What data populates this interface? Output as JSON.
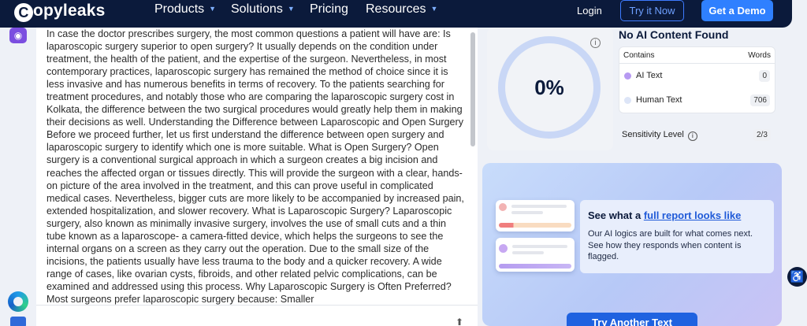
{
  "nav": {
    "logo": "opyleaks",
    "logo_mark": "C",
    "items": [
      {
        "label": "Products"
      },
      {
        "label": "Solutions"
      },
      {
        "label": "Pricing"
      },
      {
        "label": "Resources"
      }
    ],
    "login": "Login",
    "try_it_now": "Try it Now",
    "get_demo": "Get a Demo"
  },
  "text_panel": {
    "content": "In case the doctor prescribes surgery, the most common questions a patient will have are: Is laparoscopic surgery superior to open surgery? It usually depends on the condition under treatment, the health of the patient, and the expertise of the surgeon. Nevertheless, in most contemporary practices, laparoscopic surgery has remained the method of choice since it is less invasive and has numerous benefits in terms of recovery. To the patients searching for treatment procedures, and notably those who are comparing the laparoscopic surgery cost in Kolkata, the difference between the two surgical procedures would greatly help them in making their decisions as well. Understanding the Difference between Laparoscopic and Open Surgery Before we proceed further, let us first understand the difference between open surgery and laparoscopic surgery to identify which one is more suitable. What is Open Surgery? Open surgery is a conventional surgical approach in which a surgeon creates a big incision and reaches the affected organ or tissues directly. This will provide the surgeon with a clear, hands-on picture of the area involved in the treatment, and this can prove useful in complicated medical cases. Nevertheless, bigger cuts are more likely to be accompanied by increased pain, extended hospitalization, and slower recovery. What is Laparoscopic Surgery? Laparoscopic surgery, also known as minimally invasive surgery, involves the use of small cuts and a thin tube known as a laparoscope- a camera-fitted device, which helps the surgeons to see the internal organs on a screen as they carry out the operation. Due to the small size of the incisions, the patients usually have less trauma to the body and a quicker recovery. A wide range of cases, like ovarian cysts, fibroids, and other related pelvic complications, can be examined and addressed using this process. Why Laparoscopic Surgery is Often Preferred? Most surgeons prefer laparoscopic surgery because: Smaller"
  },
  "results": {
    "percent": "0%",
    "title": "No AI Content Found",
    "contains_label": "Contains",
    "words_label": "Words",
    "rows": [
      {
        "label": "AI Text",
        "count": "0",
        "color": "#b79af2"
      },
      {
        "label": "Human Text",
        "count": "706",
        "color": "#dde5f7"
      }
    ],
    "sensitivity_label": "Sensitivity Level",
    "sensitivity_value": "2/3"
  },
  "promo": {
    "title_prefix": "See what a ",
    "title_link": "full report looks like",
    "description": "Our AI logics are built for what comes next. See how they responds when content is flagged.",
    "button": "Try Another Text"
  },
  "icons": {
    "eye": "eye-icon",
    "info": "info-icon",
    "accessibility": "accessibility-icon",
    "upload": "upload-icon",
    "edge": "edge-browser-icon"
  }
}
